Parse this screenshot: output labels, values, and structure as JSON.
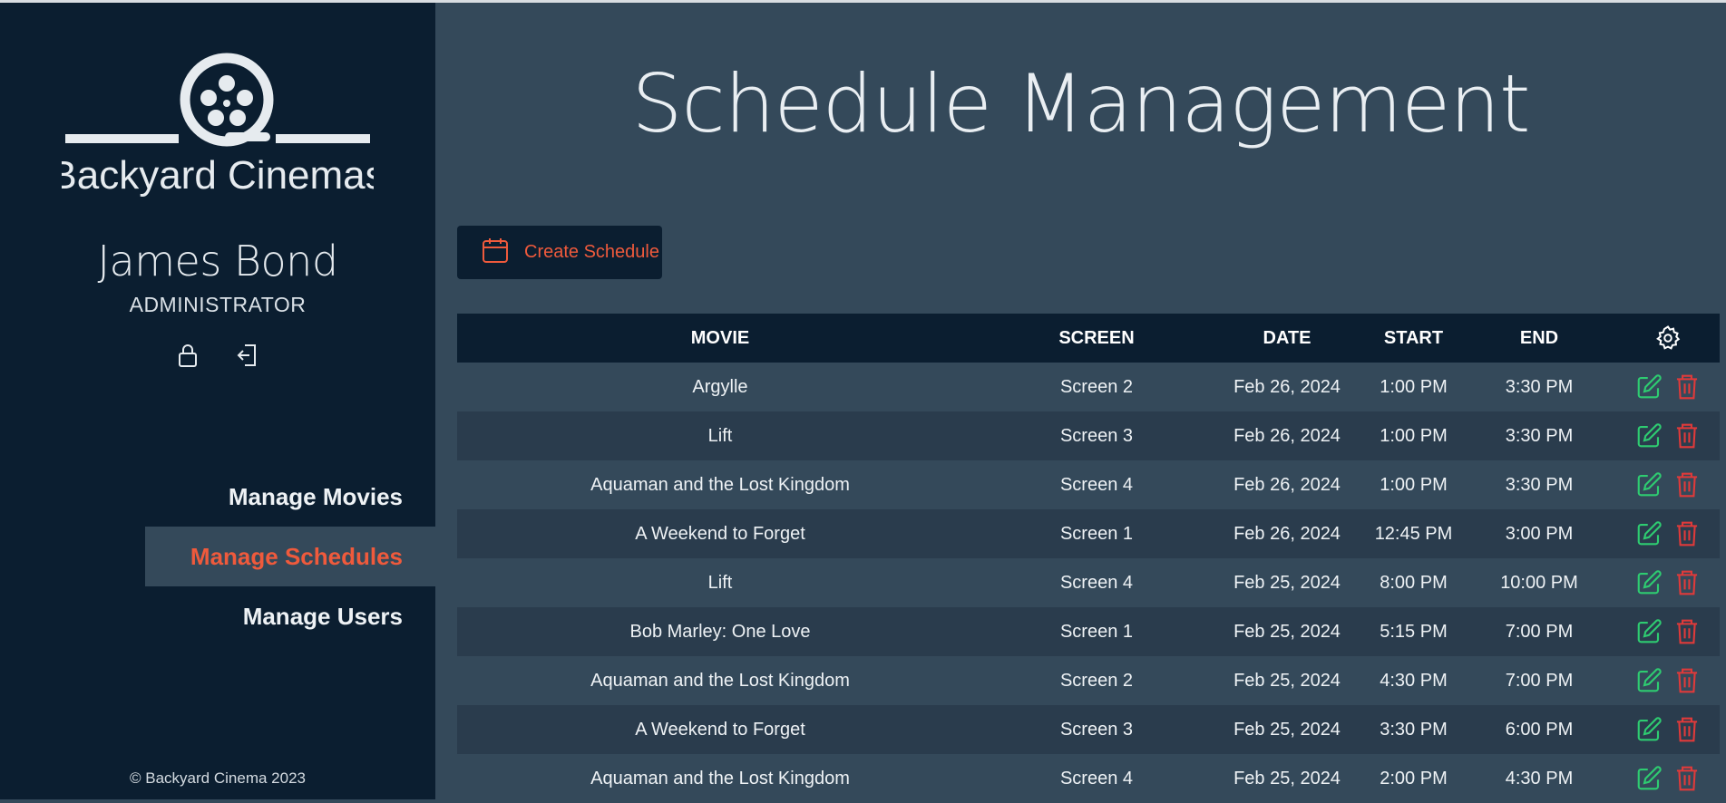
{
  "brand": {
    "name": "Backyard Cinemas",
    "logo_color": "#e6ebef"
  },
  "user": {
    "name": "James Bond",
    "role": "ADMINISTRATOR",
    "actions": [
      "lock-icon",
      "logout-icon"
    ]
  },
  "nav": {
    "items": [
      {
        "label": "Manage Movies",
        "active": false
      },
      {
        "label": "Manage Schedules",
        "active": true
      },
      {
        "label": "Manage Users",
        "active": false
      }
    ]
  },
  "footer": {
    "copyright": "© Backyard Cinema 2023"
  },
  "page": {
    "title": "Schedule Management"
  },
  "toolbar": {
    "create_label": "Create Schedule",
    "create_icon": "calendar-icon"
  },
  "table": {
    "headers": {
      "movie": "MOVIE",
      "screen": "SCREEN",
      "date": "DATE",
      "start": "START",
      "end": "END",
      "settings_icon": "gear-icon"
    },
    "rows": [
      {
        "movie": "Argylle",
        "screen": "Screen 2",
        "date": "Feb 26, 2024",
        "start": "1:00 PM",
        "end": "3:30 PM"
      },
      {
        "movie": "Lift",
        "screen": "Screen 3",
        "date": "Feb 26, 2024",
        "start": "1:00 PM",
        "end": "3:30 PM"
      },
      {
        "movie": "Aquaman and the Lost Kingdom",
        "screen": "Screen 4",
        "date": "Feb 26, 2024",
        "start": "1:00 PM",
        "end": "3:30 PM"
      },
      {
        "movie": "A Weekend to Forget",
        "screen": "Screen 1",
        "date": "Feb 26, 2024",
        "start": "12:45 PM",
        "end": "3:00 PM"
      },
      {
        "movie": "Lift",
        "screen": "Screen 4",
        "date": "Feb 25, 2024",
        "start": "8:00 PM",
        "end": "10:00 PM"
      },
      {
        "movie": "Bob Marley: One Love",
        "screen": "Screen 1",
        "date": "Feb 25, 2024",
        "start": "5:15 PM",
        "end": "7:00 PM"
      },
      {
        "movie": "Aquaman and the Lost Kingdom",
        "screen": "Screen 2",
        "date": "Feb 25, 2024",
        "start": "4:30 PM",
        "end": "7:00 PM"
      },
      {
        "movie": "A Weekend to Forget",
        "screen": "Screen 3",
        "date": "Feb 25, 2024",
        "start": "3:30 PM",
        "end": "6:00 PM"
      },
      {
        "movie": "Aquaman and the Lost Kingdom",
        "screen": "Screen 4",
        "date": "Feb 25, 2024",
        "start": "2:00 PM",
        "end": "4:30 PM"
      }
    ]
  },
  "colors": {
    "sidebar_bg": "#0b1e30",
    "main_bg": "#34495a",
    "accent": "#ef5a3c",
    "edit": "#2ecc71",
    "delete": "#e03a3a"
  }
}
